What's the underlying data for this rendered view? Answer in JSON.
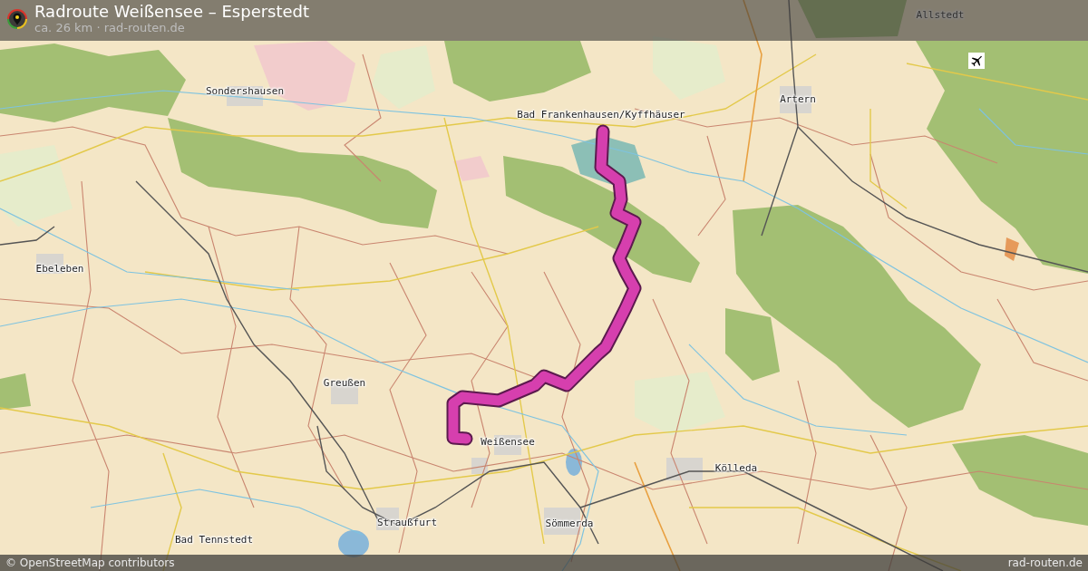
{
  "header": {
    "title": "Radroute Weißensee – Esperstedt",
    "subtitle": "ca. 26 km · rad-routen.de"
  },
  "map": {
    "places": [
      {
        "name": "Allstedt"
      },
      {
        "name": "Sondershausen"
      },
      {
        "name": "Artern"
      },
      {
        "name": "Bad Frankenhausen/Kyffhäuser"
      },
      {
        "name": "Ebeleben"
      },
      {
        "name": "Greußen"
      },
      {
        "name": "Weißensee"
      },
      {
        "name": "Kölleda"
      },
      {
        "name": "Straußfurt"
      },
      {
        "name": "Sömmerda"
      },
      {
        "name": "Bad Tennstedt"
      }
    ]
  },
  "footer": {
    "attribution": "© OpenStreetMap contributors",
    "site": "rad-routen.de"
  }
}
